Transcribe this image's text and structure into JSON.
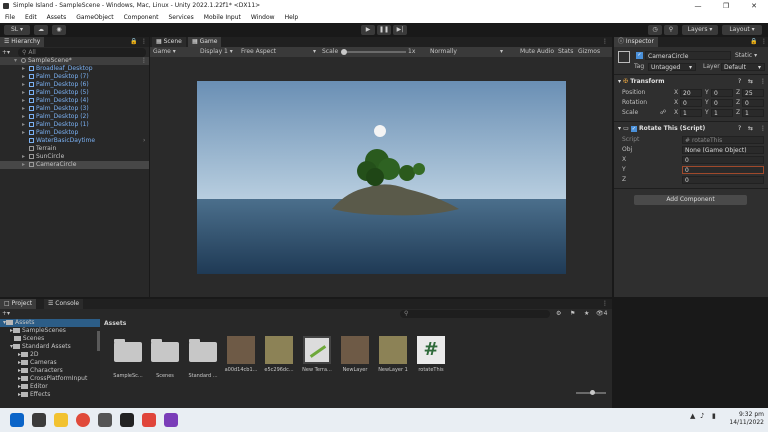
{
  "window": {
    "title": "Simple Island - SampleScene - Windows, Mac, Linux - Unity 2022.1.22f1* <DX11>"
  },
  "menu": [
    "File",
    "Edit",
    "Assets",
    "GameObject",
    "Component",
    "Services",
    "Mobile Input",
    "Window",
    "Help"
  ],
  "toolbar": {
    "account": "SL",
    "layers": "Layers",
    "layout": "Layout"
  },
  "hierarchy": {
    "tab": "Hierarchy",
    "search": "All",
    "scene": "SampleScene*",
    "items": [
      "Broadleaf_Desktop",
      "Palm_Desktop (7)",
      "Palm_Desktop (6)",
      "Palm_Desktop (5)",
      "Palm_Desktop (4)",
      "Palm_Desktop (3)",
      "Palm_Desktop (2)",
      "Palm_Desktop (1)",
      "Palm_Desktop",
      "WaterBasicDaytime",
      "Terrain",
      "SunCircle",
      "CameraCircle"
    ]
  },
  "game": {
    "tabs": [
      "Scene",
      "Game"
    ],
    "display_mode": "Game",
    "display": "Display 1",
    "aspect": "Free Aspect",
    "scale_label": "Scale",
    "scale_value": "1x",
    "normally": "Normally",
    "buttons": [
      "Mute Audio",
      "Stats",
      "Gizmos"
    ]
  },
  "inspector": {
    "tab": "Inspector",
    "object_name": "CameraCircle",
    "static": "Static",
    "tag_label": "Tag",
    "tag": "Untagged",
    "layer_label": "Layer",
    "layer": "Default",
    "transform": {
      "title": "Transform",
      "position": {
        "label": "Position",
        "x": "20",
        "y": "0",
        "z": "25"
      },
      "rotation": {
        "label": "Rotation",
        "x": "0",
        "y": "0",
        "z": "0"
      },
      "scale": {
        "label": "Scale",
        "x": "1",
        "y": "1",
        "z": "1"
      }
    },
    "script": {
      "title": "Rotate This (Script)",
      "script_label": "Script",
      "script_value": "rotateThis",
      "obj_label": "Obj",
      "obj_value": "None (Game Object)",
      "x_label": "X",
      "x_value": "0",
      "y_label": "Y",
      "y_value": "0",
      "z_label": "Z",
      "z_value": "0"
    },
    "add_component": "Add Component"
  },
  "project": {
    "tabs": [
      "Project",
      "Console"
    ],
    "tree": [
      "Assets",
      "SampleScenes",
      "Scenes",
      "Standard Assets",
      "2D",
      "Cameras",
      "Characters",
      "CrossPlatformInput",
      "Editor",
      "Effects"
    ],
    "breadcrumb": "Assets",
    "count": "4",
    "assets": [
      "SampleSc...",
      "Scenes",
      "Standard ...",
      "a00d14cb1...",
      "e5c296dc...",
      "New Terra...",
      "NewLayer",
      "NewLayer 1",
      "rotateThis"
    ]
  },
  "taskbar": {
    "time": "9:32 pm",
    "date": "14/11/2022"
  },
  "colors": {
    "accent_blue": "#7ab0f2",
    "selection": "#2c5d87"
  }
}
